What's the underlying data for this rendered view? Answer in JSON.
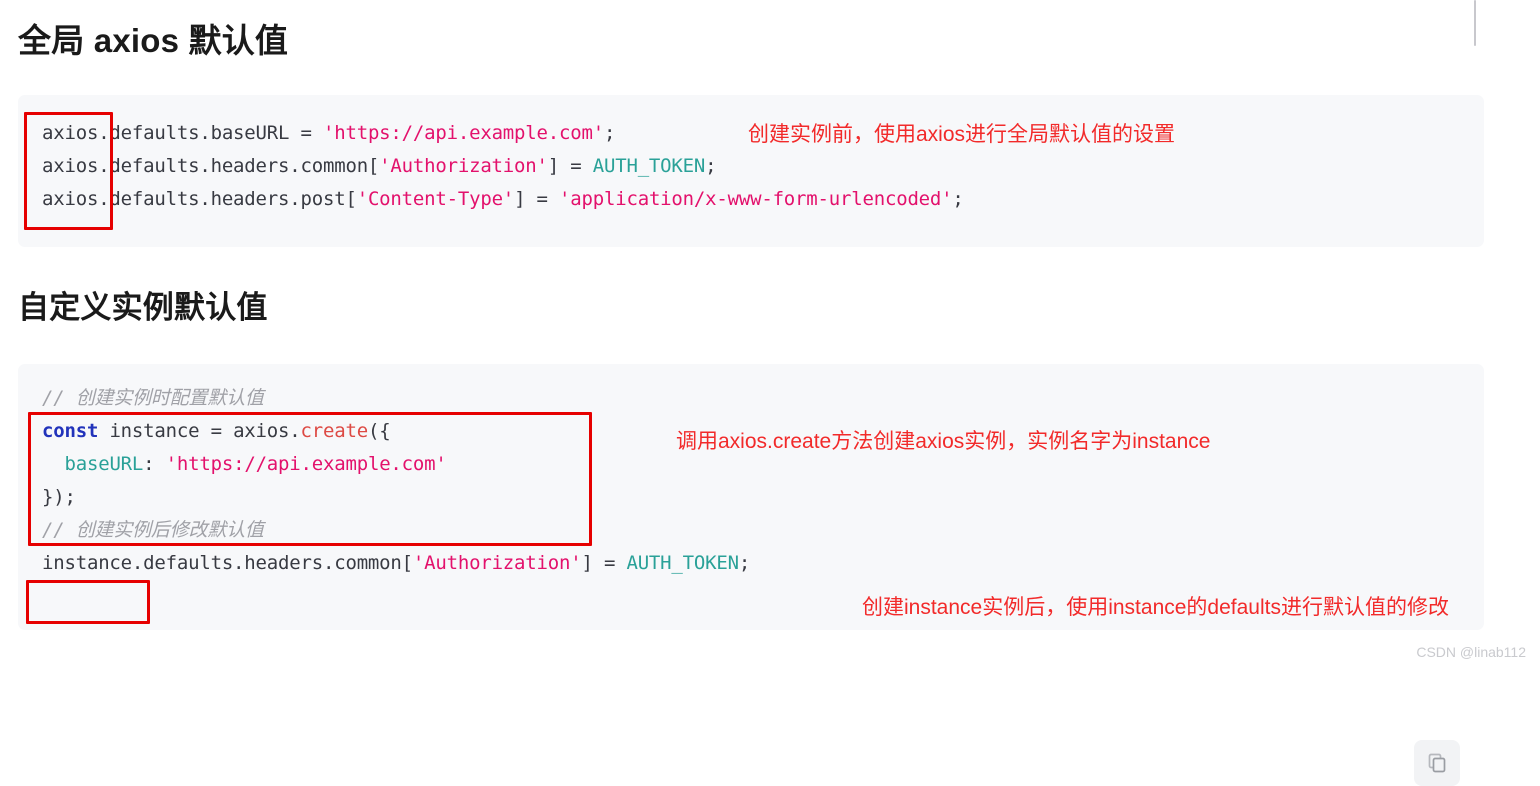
{
  "sections": {
    "global": {
      "heading": "全局 axios 默认值",
      "annotation": "创建实例前，使用axios进行全局默认值的设置",
      "code_lines": [
        {
          "tokens": [
            {
              "t": "axios.defaults.baseURL = ",
              "c": "plain"
            },
            {
              "t": "'https://api.example.com'",
              "c": "string"
            },
            {
              "t": ";",
              "c": "punc"
            }
          ]
        },
        {
          "tokens": [
            {
              "t": "axios.defaults.headers.common[",
              "c": "plain"
            },
            {
              "t": "'Authorization'",
              "c": "string"
            },
            {
              "t": "] = ",
              "c": "plain"
            },
            {
              "t": "AUTH_TOKEN",
              "c": "teal"
            },
            {
              "t": ";",
              "c": "punc"
            }
          ]
        },
        {
          "tokens": [
            {
              "t": "axios.defaults.headers.post[",
              "c": "plain"
            },
            {
              "t": "'Content-Type'",
              "c": "string"
            },
            {
              "t": "] = ",
              "c": "plain"
            },
            {
              "t": "'application/x-www-form-urlencoded'",
              "c": "string"
            },
            {
              "t": ";",
              "c": "punc"
            }
          ]
        }
      ],
      "highlight_label": "axios"
    },
    "instance": {
      "heading": "自定义实例默认值",
      "annotation_create": "调用axios.create方法创建axios实例，实例名字为instance",
      "annotation_modify": "创建instance实例后，使用instance的defaults进行默认值的修改",
      "code_lines": [
        {
          "tokens": [
            {
              "t": "// 创建实例时配置默认值",
              "c": "comment"
            }
          ]
        },
        {
          "tokens": [
            {
              "t": "const",
              "c": "const"
            },
            {
              "t": " instance = axios.",
              "c": "plain"
            },
            {
              "t": "create",
              "c": "func"
            },
            {
              "t": "({",
              "c": "punc"
            }
          ]
        },
        {
          "tokens": [
            {
              "t": "  ",
              "c": "plain"
            },
            {
              "t": "baseURL",
              "c": "teal"
            },
            {
              "t": ": ",
              "c": "plain"
            },
            {
              "t": "'https://api.example.com'",
              "c": "string"
            }
          ]
        },
        {
          "tokens": [
            {
              "t": "});",
              "c": "punc"
            }
          ]
        },
        {
          "tokens": [
            {
              "t": "// 创建实例后修改默认值",
              "c": "comment"
            }
          ]
        },
        {
          "tokens": [
            {
              "t": "instance.defaults.headers.common[",
              "c": "plain"
            },
            {
              "t": "'Authorization'",
              "c": "string"
            },
            {
              "t": "] = ",
              "c": "plain"
            },
            {
              "t": "AUTH_TOKEN",
              "c": "teal"
            },
            {
              "t": ";",
              "c": "punc"
            }
          ]
        }
      ],
      "highlight_label_create": "const instance = axios.create({",
      "highlight_label_instance": "instance",
      "copy_button_label": "copy-icon"
    }
  },
  "watermark": "CSDN @linab112",
  "colors": {
    "annotation_red": "#f22a2a",
    "highlight_box_red": "#e60000",
    "code_background": "#f7f8fa",
    "string_token": "#e3116c",
    "keyword_token": "#2233bb",
    "property_token": "#2aa198",
    "function_token": "#dd4a44",
    "comment_token": "#a0a1a7",
    "heading_text": "#1a1a1a"
  }
}
